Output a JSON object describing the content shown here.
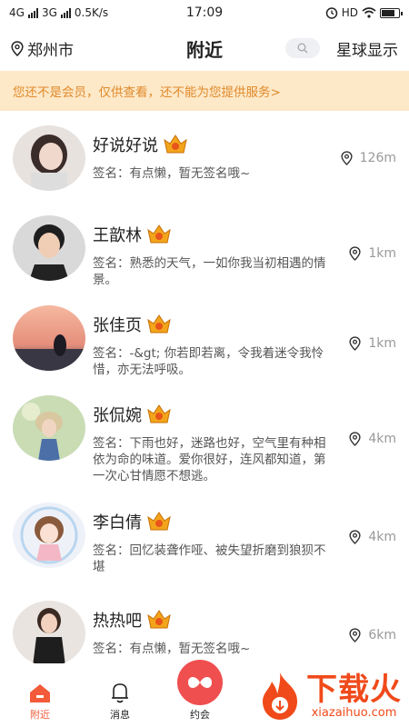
{
  "status_bar": {
    "network_left": "4G",
    "network_right": "3G",
    "speed": "0.5K/s",
    "time": "17:09",
    "hd": "HD"
  },
  "header": {
    "city": "郑州市",
    "title": "附近",
    "planet_label": "星球显示"
  },
  "banner": {
    "text": "您还不是会员，仅供查看，还不能为您提供服务>"
  },
  "users": [
    {
      "name": "好说好说",
      "signature": "签名：有点懒，暂无签名哦~",
      "distance": "126m"
    },
    {
      "name": "王歆林",
      "signature": "签名：熟悉的天气，一如你我当初相遇的情景。",
      "distance": "1km"
    },
    {
      "name": "张佳页",
      "signature": "签名：-&gt; 你若即若离，令我着迷令我怜惜，亦无法呼吸。",
      "distance": "1km"
    },
    {
      "name": "张侃婉",
      "signature": "签名：下雨也好，迷路也好，空气里有种相依为命的味道。爱你很好，连风都知道，第一次心甘情愿不想逃。",
      "distance": "4km"
    },
    {
      "name": "李白倩",
      "signature": "签名：回忆装聋作哑、被失望折磨到狼狈不堪",
      "distance": "4km"
    },
    {
      "name": "热热吧",
      "signature": "签名：有点懒，暂无签名哦~",
      "distance": "6km"
    }
  ],
  "tabbar": {
    "nearby": "附近",
    "messages": "消息",
    "meet": "约会"
  },
  "watermark": {
    "cn": "下载火",
    "en": "xiazaihuo.com"
  },
  "colors": {
    "accent": "#f25a3a",
    "banner_bg": "#fde8c7",
    "banner_text": "#e08a2b",
    "vip_gold": "#f2a51a"
  }
}
